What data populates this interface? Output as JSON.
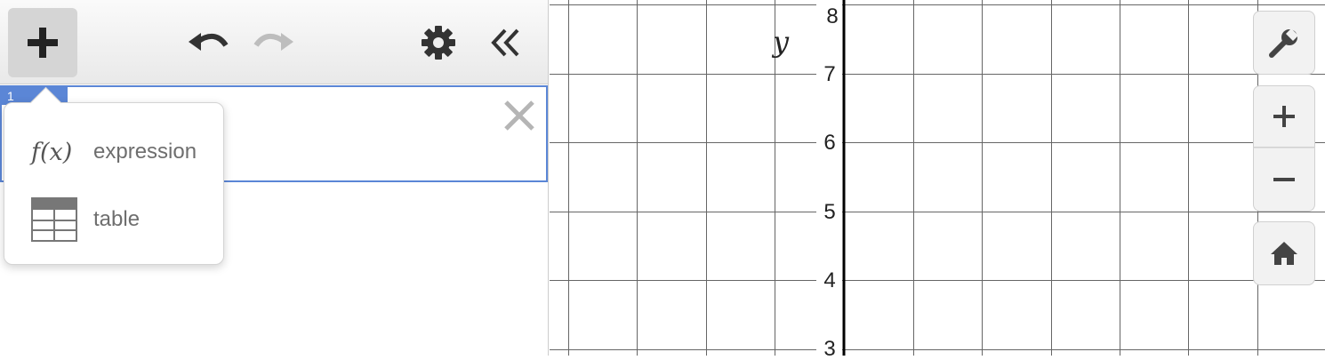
{
  "toolbar": {
    "add_icon": "plus-icon",
    "undo_icon": "undo-icon",
    "redo_icon": "redo-icon",
    "settings_icon": "gear-icon",
    "collapse_icon": "double-chevron-left-icon"
  },
  "expression_list": {
    "items": [
      {
        "index": "1",
        "value": ""
      }
    ]
  },
  "add_menu": {
    "items": [
      {
        "icon_text": "f(x)",
        "label": "expression"
      },
      {
        "icon": "table-icon",
        "label": "table"
      }
    ]
  },
  "graph": {
    "y_axis_label": "y",
    "y_ticks": [
      "8",
      "7",
      "6",
      "5",
      "4",
      "3"
    ],
    "colors": {
      "grid": "#666666",
      "axis": "#000000",
      "accent": "#5b86d6"
    }
  },
  "controls": {
    "wrench_icon": "wrench-icon",
    "zoom_in_icon": "plus-icon",
    "zoom_out_icon": "minus-icon",
    "home_icon": "home-icon"
  }
}
